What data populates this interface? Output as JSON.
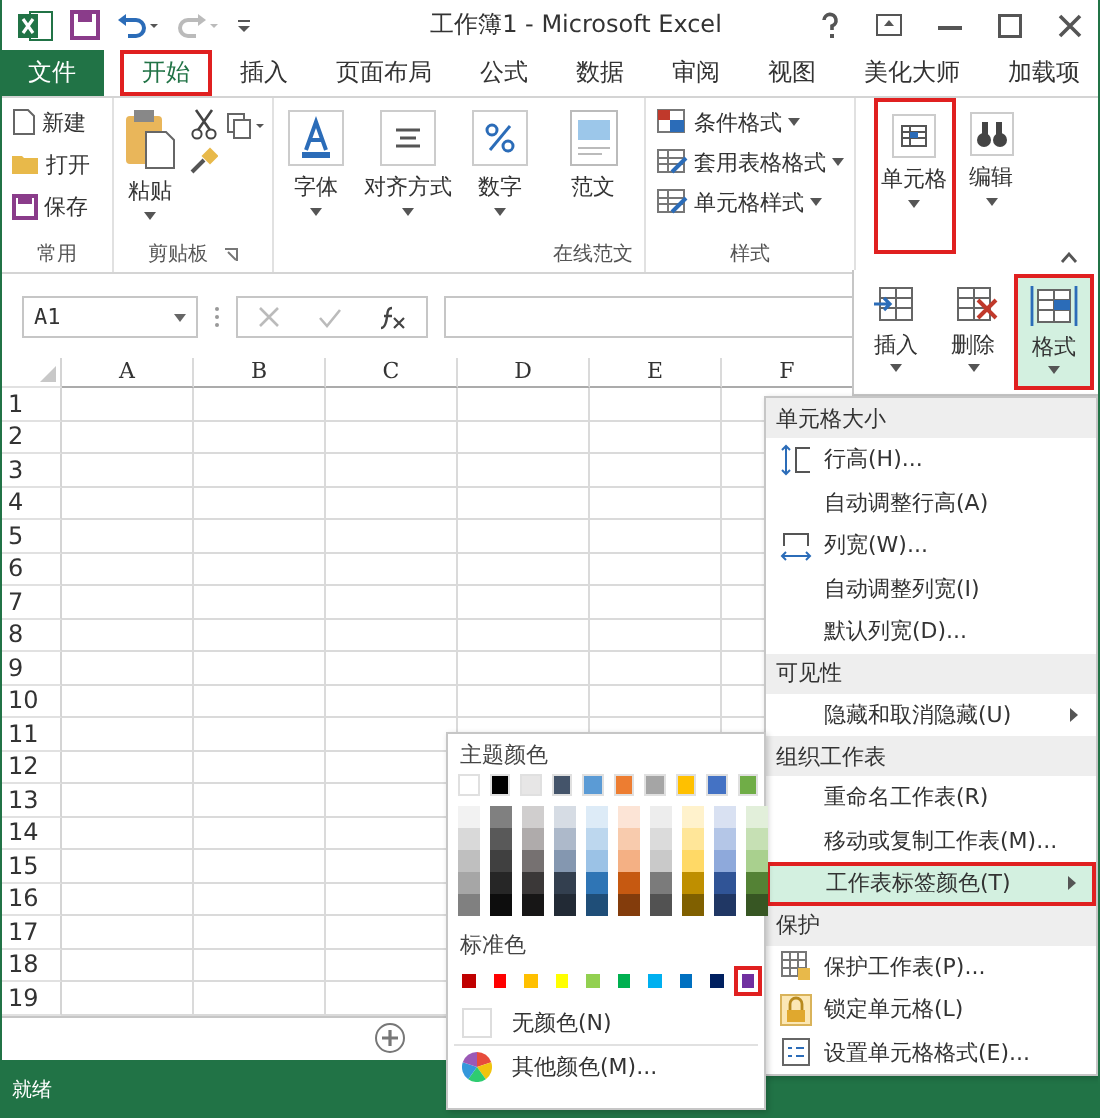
{
  "window": {
    "title": "工作簿1 - Microsoft Excel"
  },
  "ribbon_tabs": [
    {
      "label": "文件",
      "kind": "file",
      "selected": false
    },
    {
      "label": "开始",
      "kind": "tab",
      "selected": true
    },
    {
      "label": "插入",
      "kind": "tab",
      "selected": false
    },
    {
      "label": "页面布局",
      "kind": "tab",
      "selected": false
    },
    {
      "label": "公式",
      "kind": "tab",
      "selected": false
    },
    {
      "label": "数据",
      "kind": "tab",
      "selected": false
    },
    {
      "label": "审阅",
      "kind": "tab",
      "selected": false
    },
    {
      "label": "视图",
      "kind": "tab",
      "selected": false
    },
    {
      "label": "美化大师",
      "kind": "tab",
      "selected": false
    },
    {
      "label": "加载项",
      "kind": "tab",
      "selected": false
    }
  ],
  "ribbon": {
    "common": {
      "label": "常用",
      "buttons": [
        "新建",
        "打开",
        "保存"
      ]
    },
    "clipboard": {
      "label": "剪贴板",
      "paste": "粘贴"
    },
    "collapsed_groups": [
      "字体",
      "对齐方式",
      "数字"
    ],
    "template": {
      "button": "范文",
      "label": "在线范文"
    },
    "styles": {
      "label": "样式",
      "buttons": [
        "条件格式",
        "套用表格格式",
        "单元格样式"
      ]
    },
    "cells_button": {
      "label": "单元格",
      "selected": true
    },
    "edit_button": {
      "label": "编辑",
      "selected": false
    }
  },
  "cells_dropdown": [
    {
      "label": "插入",
      "selected": false
    },
    {
      "label": "删除",
      "selected": false
    },
    {
      "label": "格式",
      "selected": true
    }
  ],
  "formula_bar": {
    "name_box": "A1"
  },
  "columns": [
    "A",
    "B",
    "C",
    "D",
    "E",
    "F"
  ],
  "rows": [
    "1",
    "2",
    "3",
    "4",
    "5",
    "6",
    "7",
    "8",
    "9",
    "10",
    "11",
    "12",
    "13",
    "14",
    "15",
    "16",
    "17",
    "18",
    "19"
  ],
  "format_menu": [
    {
      "kind": "header",
      "label": "单元格大小"
    },
    {
      "kind": "item",
      "label": "行高(H)...",
      "submenu": false,
      "selected": false
    },
    {
      "kind": "item",
      "label": "自动调整行高(A)",
      "submenu": false,
      "selected": false
    },
    {
      "kind": "item",
      "label": "列宽(W)...",
      "submenu": false,
      "selected": false
    },
    {
      "kind": "item",
      "label": "自动调整列宽(I)",
      "submenu": false,
      "selected": false
    },
    {
      "kind": "item",
      "label": "默认列宽(D)...",
      "submenu": false,
      "selected": false
    },
    {
      "kind": "header",
      "label": "可见性"
    },
    {
      "kind": "item",
      "label": "隐藏和取消隐藏(U)",
      "submenu": true,
      "selected": false
    },
    {
      "kind": "header",
      "label": "组织工作表"
    },
    {
      "kind": "item",
      "label": "重命名工作表(R)",
      "submenu": false,
      "selected": false
    },
    {
      "kind": "item",
      "label": "移动或复制工作表(M)...",
      "submenu": false,
      "selected": false
    },
    {
      "kind": "item",
      "label": "工作表标签颜色(T)",
      "submenu": true,
      "selected": true
    },
    {
      "kind": "header",
      "label": "保护"
    },
    {
      "kind": "item",
      "label": "保护工作表(P)...",
      "submenu": false,
      "selected": false
    },
    {
      "kind": "item",
      "label": "锁定单元格(L)",
      "submenu": false,
      "selected": false
    },
    {
      "kind": "item",
      "label": "设置单元格格式(E)...",
      "submenu": false,
      "selected": false
    }
  ],
  "tab_color_palette": {
    "theme_header": "主题颜色",
    "theme_colors": [
      {
        "color": "#ffffff",
        "shades": [
          {
            "color": "#f2f2f2"
          },
          {
            "color": "#d9d9d9"
          },
          {
            "color": "#bfbfbf"
          },
          {
            "color": "#a6a6a6"
          },
          {
            "color": "#808080"
          }
        ]
      },
      {
        "color": "#000000",
        "shades": [
          {
            "color": "#808080"
          },
          {
            "color": "#595959"
          },
          {
            "color": "#404040"
          },
          {
            "color": "#262626"
          },
          {
            "color": "#0d0d0d"
          }
        ]
      },
      {
        "color": "#e7e6e6",
        "shades": [
          {
            "color": "#d0cece"
          },
          {
            "color": "#afabab"
          },
          {
            "color": "#767171"
          },
          {
            "color": "#3b3838"
          },
          {
            "color": "#171616"
          }
        ]
      },
      {
        "color": "#44546a",
        "shades": [
          {
            "color": "#d6dce4"
          },
          {
            "color": "#adb9ca"
          },
          {
            "color": "#8497b0"
          },
          {
            "color": "#333f4f"
          },
          {
            "color": "#222a35"
          }
        ]
      },
      {
        "color": "#5b9bd5",
        "shades": [
          {
            "color": "#ddebf7"
          },
          {
            "color": "#bdd7ee"
          },
          {
            "color": "#9bc2e6"
          },
          {
            "color": "#2f75b5"
          },
          {
            "color": "#1f4e78"
          }
        ]
      },
      {
        "color": "#ed7d31",
        "shades": [
          {
            "color": "#fce4d6"
          },
          {
            "color": "#f8cbad"
          },
          {
            "color": "#f4b084"
          },
          {
            "color": "#c65911"
          },
          {
            "color": "#833c0c"
          }
        ]
      },
      {
        "color": "#a5a5a5",
        "shades": [
          {
            "color": "#ededed"
          },
          {
            "color": "#dbdbdb"
          },
          {
            "color": "#c9c9c9"
          },
          {
            "color": "#7b7b7b"
          },
          {
            "color": "#525252"
          }
        ]
      },
      {
        "color": "#ffc000",
        "shades": [
          {
            "color": "#fff2cc"
          },
          {
            "color": "#ffe699"
          },
          {
            "color": "#ffd966"
          },
          {
            "color": "#bf8f00"
          },
          {
            "color": "#806000"
          }
        ]
      },
      {
        "color": "#4472c4",
        "shades": [
          {
            "color": "#d9e1f2"
          },
          {
            "color": "#b4c6e7"
          },
          {
            "color": "#8ea9db"
          },
          {
            "color": "#305496"
          },
          {
            "color": "#203764"
          }
        ]
      },
      {
        "color": "#70ad47",
        "shades": [
          {
            "color": "#e2efda"
          },
          {
            "color": "#c6e0b4"
          },
          {
            "color": "#a9d08e"
          },
          {
            "color": "#548235"
          },
          {
            "color": "#375623"
          }
        ]
      }
    ],
    "standard_header": "标准色",
    "standard_colors": [
      {
        "color": "#c00000",
        "selected": false
      },
      {
        "color": "#ff0000",
        "selected": false
      },
      {
        "color": "#ffc000",
        "selected": false
      },
      {
        "color": "#ffff00",
        "selected": false
      },
      {
        "color": "#92d050",
        "selected": false
      },
      {
        "color": "#00b050",
        "selected": false
      },
      {
        "color": "#00b0f0",
        "selected": false
      },
      {
        "color": "#0070c0",
        "selected": false
      },
      {
        "color": "#002060",
        "selected": false
      },
      {
        "color": "#7030a0",
        "selected": true
      }
    ],
    "no_color": "无颜色(N)",
    "more_colors": "其他颜色(M)..."
  },
  "status_bar": {
    "text": "就绪"
  }
}
